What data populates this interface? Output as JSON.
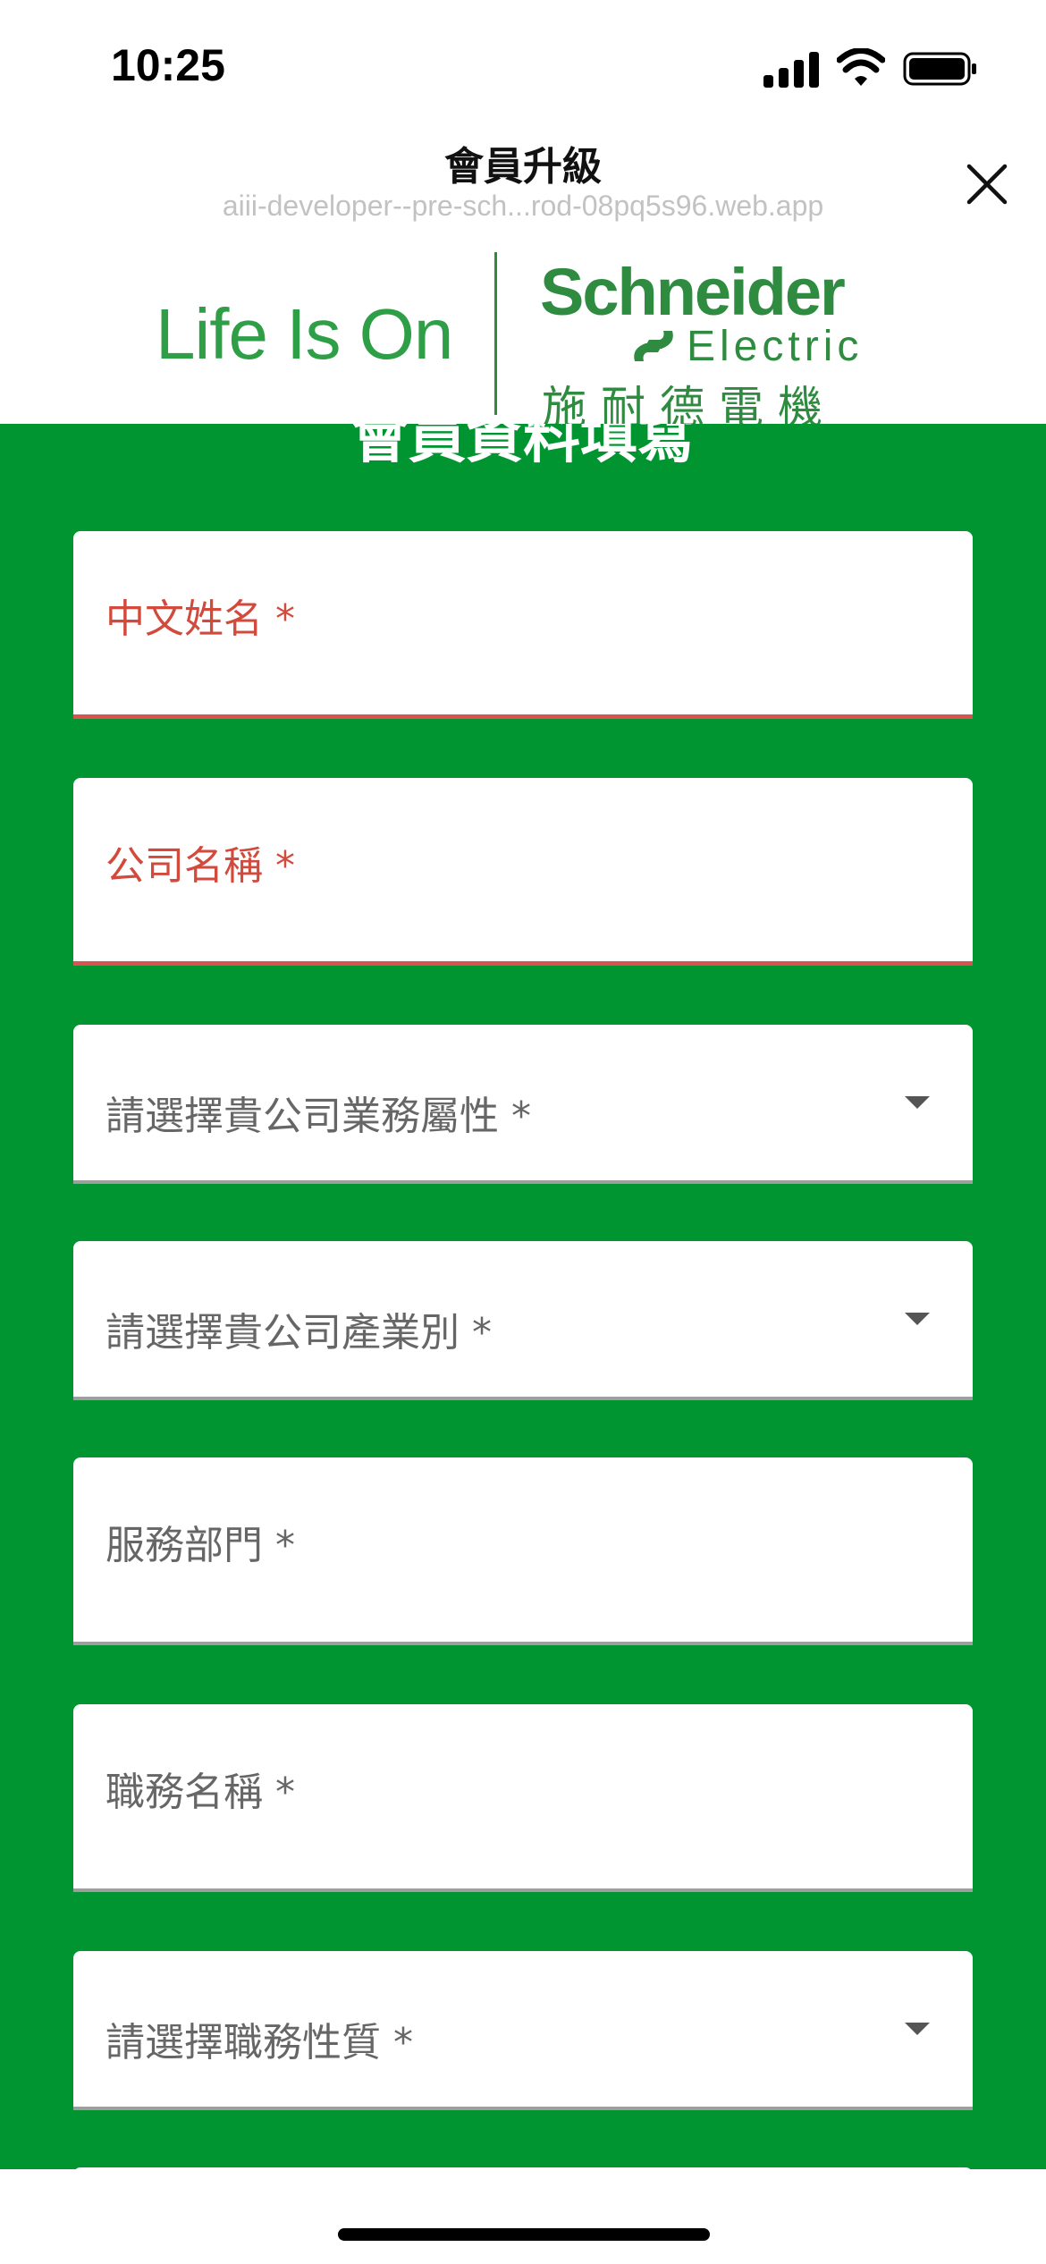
{
  "status_bar": {
    "time": "10:25"
  },
  "nav": {
    "title": "會員升級",
    "url": "aiii-developer--pre-sch...rod-08pq5s96.web.app"
  },
  "brand": {
    "tagline": "Life Is On",
    "name": "Schneider",
    "sub": "Electric",
    "chinese": "施耐德電機",
    "color": "#2e8b3f"
  },
  "form": {
    "title": "會員資料填寫",
    "background": "#009530",
    "fields": [
      {
        "label": "中文姓名 *",
        "type": "text",
        "state": "error"
      },
      {
        "label": "公司名稱 *",
        "type": "text",
        "state": "error"
      },
      {
        "label": "請選擇貴公司業務屬性 *",
        "type": "select",
        "state": "normal"
      },
      {
        "label": "請選擇貴公司產業別 *",
        "type": "select",
        "state": "normal"
      },
      {
        "label": "服務部門 *",
        "type": "text",
        "state": "normal"
      },
      {
        "label": "職務名稱 *",
        "type": "text",
        "state": "normal"
      },
      {
        "label": "請選擇職務性質 *",
        "type": "select",
        "state": "normal"
      }
    ],
    "error_color": "#d24a3c"
  },
  "icons": [
    "signal-icon",
    "wifi-icon",
    "battery-icon",
    "close-icon",
    "chevron-down-icon",
    "electric-logo-icon"
  ]
}
